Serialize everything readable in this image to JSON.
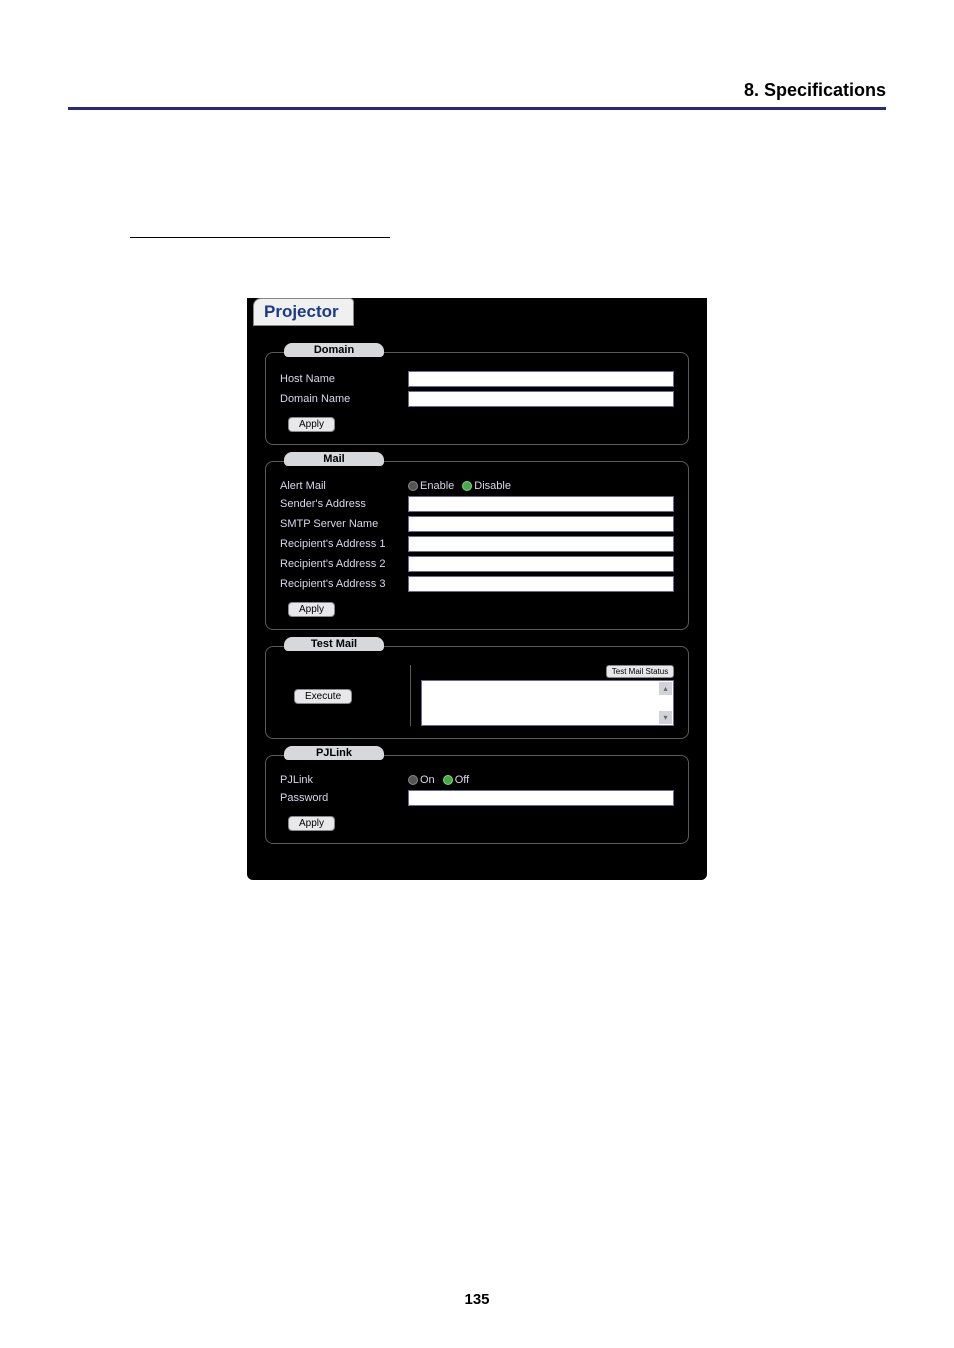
{
  "header": {
    "title": "8. Specifications"
  },
  "page_number": "135",
  "screenshot": {
    "tab": "Projector",
    "groups": {
      "domain": {
        "legend": "Domain",
        "host_name_label": "Host Name",
        "domain_name_label": "Domain Name",
        "apply": "Apply"
      },
      "mail": {
        "legend": "Mail",
        "alert_mail_label": "Alert Mail",
        "enable": "Enable",
        "disable": "Disable",
        "senders_address_label": "Sender's Address",
        "smtp_label": "SMTP Server Name",
        "recip1_label": "Recipient's Address 1",
        "recip2_label": "Recipient's Address 2",
        "recip3_label": "Recipient's Address 3",
        "apply": "Apply"
      },
      "testmail": {
        "legend": "Test Mail",
        "status_btn": "Test Mail Status",
        "execute": "Execute"
      },
      "pjlink": {
        "legend": "PJLink",
        "pjlink_label": "PJLink",
        "on": "On",
        "off": "Off",
        "password_label": "Password",
        "apply": "Apply"
      }
    }
  }
}
